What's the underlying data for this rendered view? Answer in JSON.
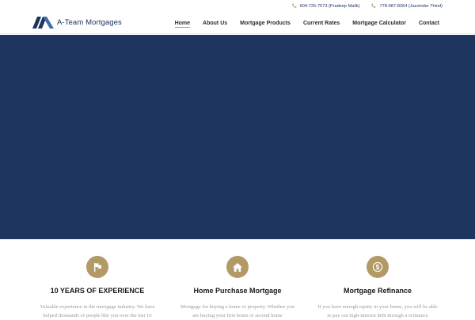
{
  "brand": {
    "name": "A-Team Mortgages",
    "color": "#1d3461",
    "accent": "#b29a66",
    "hero_bg": "#1d355f"
  },
  "contacts": [
    {
      "icon": "phone-icon",
      "text": "604-725-7573 (Pradeep Malik)"
    },
    {
      "icon": "phone-icon",
      "text": "778-987-8264 (Jasvinder Thind)"
    }
  ],
  "nav": {
    "items": [
      {
        "label": "Home",
        "active": true
      },
      {
        "label": "About Us"
      },
      {
        "label": "Mortgage Products"
      },
      {
        "label": "Current Rates"
      },
      {
        "label": "Mortgage Calculator"
      },
      {
        "label": "Contact"
      }
    ]
  },
  "features": [
    {
      "icon": "flag-icon",
      "title": "10 YEARS OF EXPERIENCE",
      "lines": [
        "Valuable experience in the mortgage industry. We have",
        "helped thousands of people like you over the last 10"
      ]
    },
    {
      "icon": "home-icon",
      "title": "Home Purchase Mortgage",
      "lines": [
        "Mortgage for buying a home or property. Whether you",
        "are buying your first home or second home"
      ]
    },
    {
      "icon": "dollar-icon",
      "title": "Mortgage Refinance",
      "lines": [
        "If you have enough equity in your home, you will be able",
        "to pay out high-interest debt through a refinance"
      ]
    }
  ]
}
